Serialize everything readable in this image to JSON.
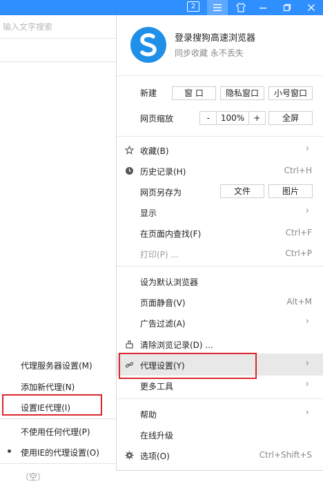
{
  "titlebar": {
    "tab_count": "2",
    "icons": [
      "tab-count-icon",
      "menu-icon",
      "skin-icon",
      "minimize-icon",
      "restore-icon",
      "close-icon"
    ],
    "color": "#2f8fff"
  },
  "search": {
    "placeholder": "输入文字搜索"
  },
  "account": {
    "title": "登录搜狗高速浏览器",
    "subtitle": "同步收藏 永不丢失"
  },
  "new_row": {
    "label": "新建",
    "window": "窗 口",
    "private": "隐私窗口",
    "small": "小号窗口"
  },
  "zoom_row": {
    "label": "网页缩放",
    "minus": "-",
    "value": "100%",
    "plus": "+",
    "fullscreen": "全屏"
  },
  "menu": {
    "favorites": "收藏(B)",
    "history": "历史记录(H)",
    "history_shortcut": "Ctrl+H",
    "save_as": "网页另存为",
    "save_file": "文件",
    "save_image": "图片",
    "display": "显示",
    "find": "在页面内查找(F)",
    "find_shortcut": "Ctrl+F",
    "print": "打印(P) ...",
    "print_shortcut": "Ctrl+P",
    "default_browser": "设为默认浏览器",
    "mute": "页面静音(V)",
    "mute_shortcut": "Alt+M",
    "adfilter": "广告过滤(A)",
    "clear": "清除浏览记录(D) ...",
    "proxy": "代理设置(Y)",
    "more_tools": "更多工具",
    "help": "帮助",
    "upgrade": "在线升级",
    "options": "选项(O)",
    "options_shortcut": "Ctrl+Shift+S"
  },
  "proxy_submenu": {
    "server": "代理服务器设置(M)",
    "add": "添加新代理(N)",
    "ie": "设置IE代理(I)",
    "none": "不使用任何代理(P)",
    "use_ie": "使用IE的代理设置(O)",
    "empty": "（空）"
  }
}
